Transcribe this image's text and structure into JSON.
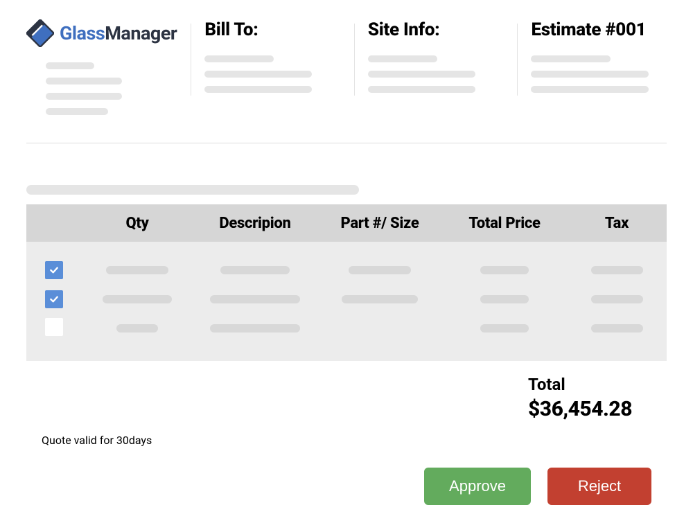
{
  "logo": {
    "part1": "Glass",
    "part2": "Manager"
  },
  "headers": {
    "bill_to": "Bill To:",
    "site_info": "Site Info:",
    "estimate": "Estimate #001"
  },
  "table": {
    "columns": {
      "qty": "Qty",
      "description": "Descripion",
      "part": "Part #/ Size",
      "total_price": "Total Price",
      "tax": "Tax"
    },
    "rows": [
      {
        "checked": true
      },
      {
        "checked": true
      },
      {
        "checked": false
      }
    ]
  },
  "totals": {
    "label": "Total",
    "amount": "$36,454.28"
  },
  "note": "Quote valid for 30days",
  "buttons": {
    "approve": "Approve",
    "reject": "Reject"
  }
}
